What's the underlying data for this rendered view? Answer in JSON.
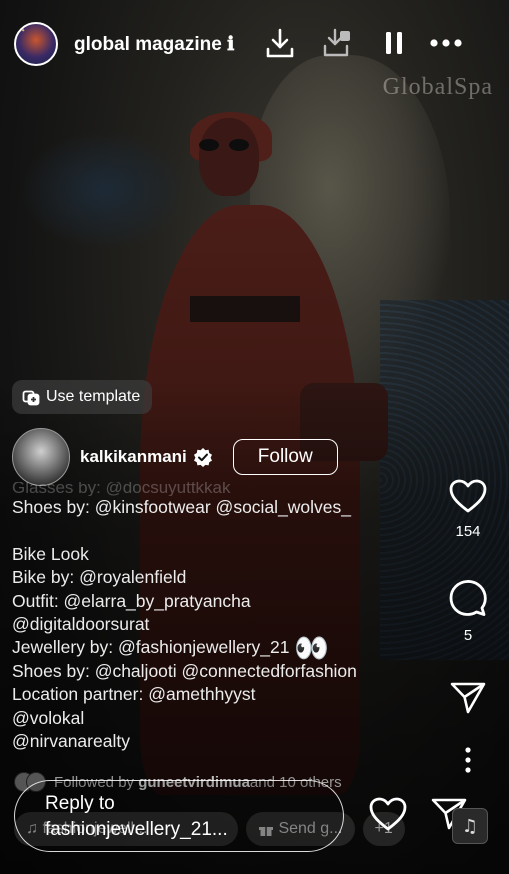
{
  "header": {
    "account_name": "global magazine",
    "name_suffix": "ℹ",
    "watermark": "GlobalSpa"
  },
  "post": {
    "use_template_label": "Use template",
    "author": "kalkikanmani",
    "follow_label": "Follow",
    "caption_faded": "Glasses by: @docsuyuttkkak",
    "caption_lines": [
      "Shoes by: @kinsfootwear @social_wolves_",
      "",
      "Bike Look",
      "Bike by: @royalenfield",
      "Outfit: @elarra_by_pratyancha",
      "@digitaldoorsurat",
      "Jewellery by: @fashionjewellery_21",
      "Shoes by: @chaljooti @connectedforfashion",
      "Location partner: @amethhyyst",
      "@volokal",
      "@nirvanarealty"
    ],
    "eyes_emoji": "👀"
  },
  "actions": {
    "likes": "154",
    "comments": "5"
  },
  "social": {
    "followed_prefix": "Followed by ",
    "followed_user": "guneetvirdimua",
    "followed_suffix": " and 10 others"
  },
  "audio": {
    "track": "♫ fashionjewell...",
    "gift": "Send g...",
    "more": "+1",
    "music_icon": "♫"
  },
  "reply": {
    "placeholder_line1": "Reply to",
    "placeholder_line2": "fashionjewellery_21..."
  }
}
